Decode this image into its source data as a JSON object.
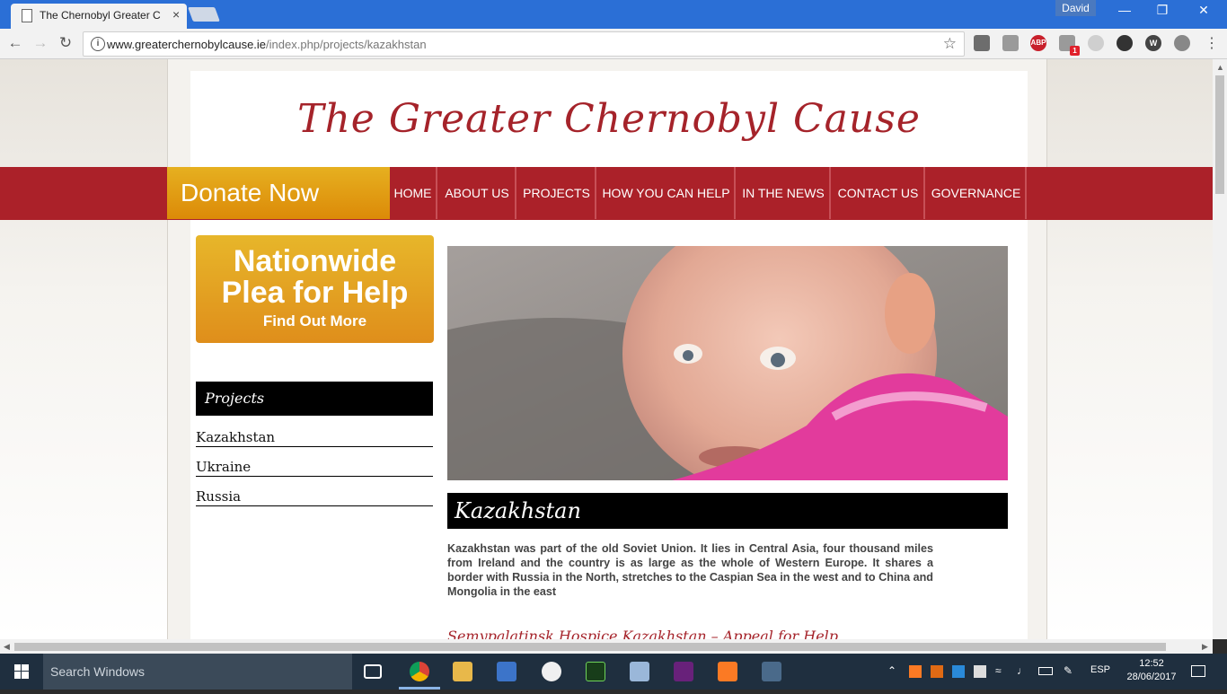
{
  "browser": {
    "tab_title": "The Chernobyl Greater C",
    "tab_close": "×",
    "profile_name": "David",
    "url_host": "www.greaterchernobylcause.ie",
    "url_path": "/index.php/projects/kazakhstan",
    "extensions": [
      "mail",
      "cube",
      "ABP",
      "puzzle",
      "gear-grey",
      "gear",
      "W",
      "power"
    ],
    "extension_badge": "1"
  },
  "site": {
    "title": "The Greater Chernobyl Cause",
    "donate_label": "Donate Now",
    "nav": [
      "HOME",
      "ABOUT US",
      "PROJECTS",
      "HOW YOU CAN HELP",
      "IN THE NEWS",
      "CONTACT US",
      "GOVERNANCE"
    ],
    "plea": {
      "line1": "Nationwide",
      "line2": "Plea for Help",
      "link": "Find Out More"
    },
    "sidebar": {
      "heading": "Projects",
      "items": [
        "Kazakhstan",
        "Ukraine",
        "Russia"
      ]
    },
    "section_heading": "Kazakhstan",
    "intro": "Kazakhstan was part of the old Soviet Union. It lies in Central Asia, four thousand miles from Ireland and the country is as large as the whole of Western Europe. It shares a border with Russia in the North, stretches to the Caspian Sea in the west and to China and Mongolia in the east",
    "subheading_partial": "Semypalatinsk Hospice Kazakhstan – Appeal for Help"
  },
  "taskbar": {
    "search_placeholder": "Search Windows",
    "lang": "ESP",
    "time": "12:52",
    "date": "28/06/2017"
  },
  "colors": {
    "brand_red": "#ab2129",
    "title_red": "#a5232a",
    "donate_gold": "#e6b020",
    "chrome_blue": "#2b6fd6"
  }
}
